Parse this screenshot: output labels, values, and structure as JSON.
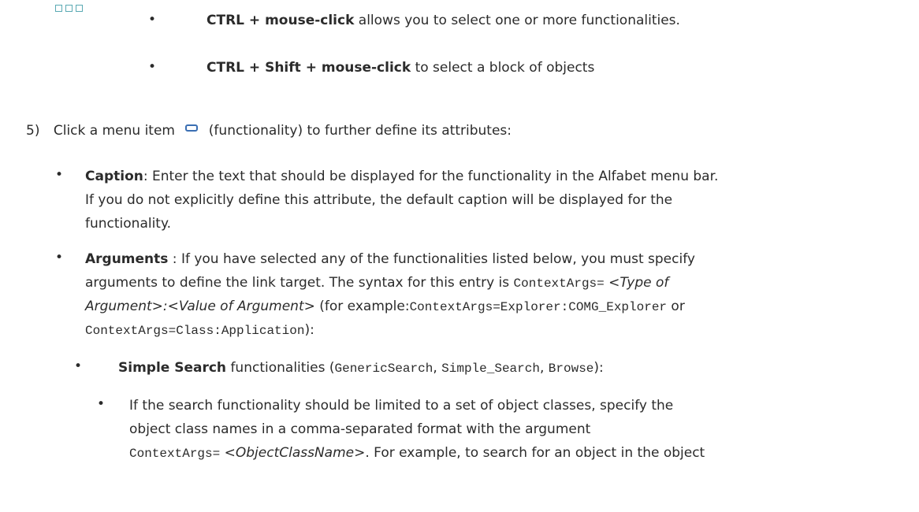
{
  "step5": {
    "number": "5)",
    "before_icon": "Click a menu item",
    "after_icon": "(functionality) to further define its attributes:",
    "icon": "menu-item-icon"
  },
  "bullets_top": [
    {
      "bold": "CTRL + mouse-click",
      "rest": " allows you to select one or more functionalities."
    },
    {
      "bold": "CTRL + Shift + mouse-click",
      "rest": " to select a block of objects"
    }
  ],
  "caption": {
    "label": "Caption",
    "line1": ": Enter the text that should be displayed for the functionality in the Alfabet menu bar.",
    "line2": "If you do not explicitly define this attribute, the default caption will be displayed for the",
    "line3": "functionality."
  },
  "arguments": {
    "label": "Arguments",
    "line1": " : If you have selected any of the functionalities listed below, you must specify",
    "line2a": "arguments to define the link target. The syntax for this entry is ",
    "line2_code": "ContextArgs=",
    "line2b": " <Type of",
    "line3a": "Argument>:<Value of Argument>",
    "line3b": " (for example:",
    "line3_code": "ContextArgs=Explorer:COMG_Explorer",
    "line3c": " or",
    "line4_code": "ContextArgs=Class:Application",
    "line4b": "):"
  },
  "simple_search": {
    "label": "Simple Search",
    "text": " functionalities (",
    "code1": "GenericSearch",
    "sep1": ", ",
    "code2": "Simple_Search",
    "sep2": ", ",
    "code3": "Browse",
    "end": "):"
  },
  "search_limit": {
    "line1": "If the search functionality should be limited to a set of object classes, specify the",
    "line2": "object class names in a comma-separated format with the argument",
    "line3_code": "ContextArgs=",
    "line3_italic": " <ObjectClassName>",
    "line3_rest": ". For example, to search for an object in the object"
  },
  "bullet_char": "•"
}
